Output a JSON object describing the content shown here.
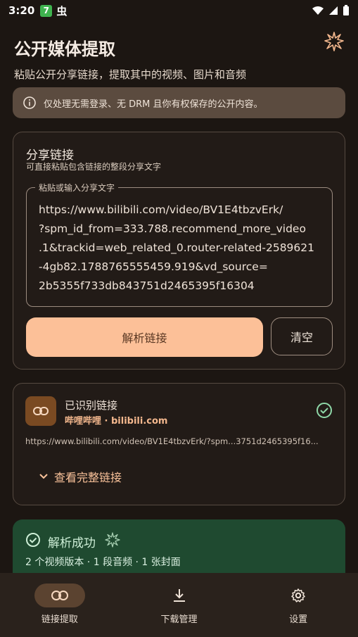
{
  "status_bar": {
    "time": "3:20",
    "badge": "7",
    "app_glyph": "虫",
    "icons": [
      "wifi-icon",
      "signal-icon",
      "battery-icon"
    ]
  },
  "header": {
    "title": "公开媒体提取",
    "subtitle": "粘贴公开分享链接，提取其中的视频、图片和音频",
    "action_icon": "sparkle-icon"
  },
  "notice": {
    "icon": "info-icon",
    "text": "仅处理无需登录、无 DRM 且你有权保存的公开内容。"
  },
  "share": {
    "title": "分享链接",
    "hint": "可直接粘贴包含链接的整段分享文字",
    "input_label": "粘贴或输入分享文字",
    "input_value": "https://www.bilibili.com/video/BV1E4tbzvErk/\n?spm_id_from=333.788.recommend_more_video\n.1&trackid=web_related_0.router-related-2589621\n-4gb82.1788765555459.919&vd_source=\n2b5355f733db843751d2465395f16304",
    "parse_button": "解析链接",
    "clear_button": "清空"
  },
  "recognized": {
    "icon": "link-icon",
    "title": "已识别链接",
    "source": "哔哩哔哩 · bilibili.com",
    "url_preview": "https://www.bilibili.com/video/BV1E4tbzvErk/?spm...3751d2465395f16...",
    "expand_label": "查看完整链接",
    "status_icon": "check-circle-icon"
  },
  "result": {
    "title": "解析成功",
    "detail": "2 个视频版本 · 1 段音频 · 1 张封面",
    "color": "#1f4a30"
  },
  "bottom_nav": [
    {
      "label": "链接提取",
      "icon": "link-icon",
      "active": true
    },
    {
      "label": "下载管理",
      "icon": "download-icon",
      "active": false
    },
    {
      "label": "设置",
      "icon": "gear-icon",
      "active": false
    }
  ],
  "colors": {
    "background": "#1c1612",
    "accent": "#fcc098",
    "success": "#1f4a30"
  }
}
